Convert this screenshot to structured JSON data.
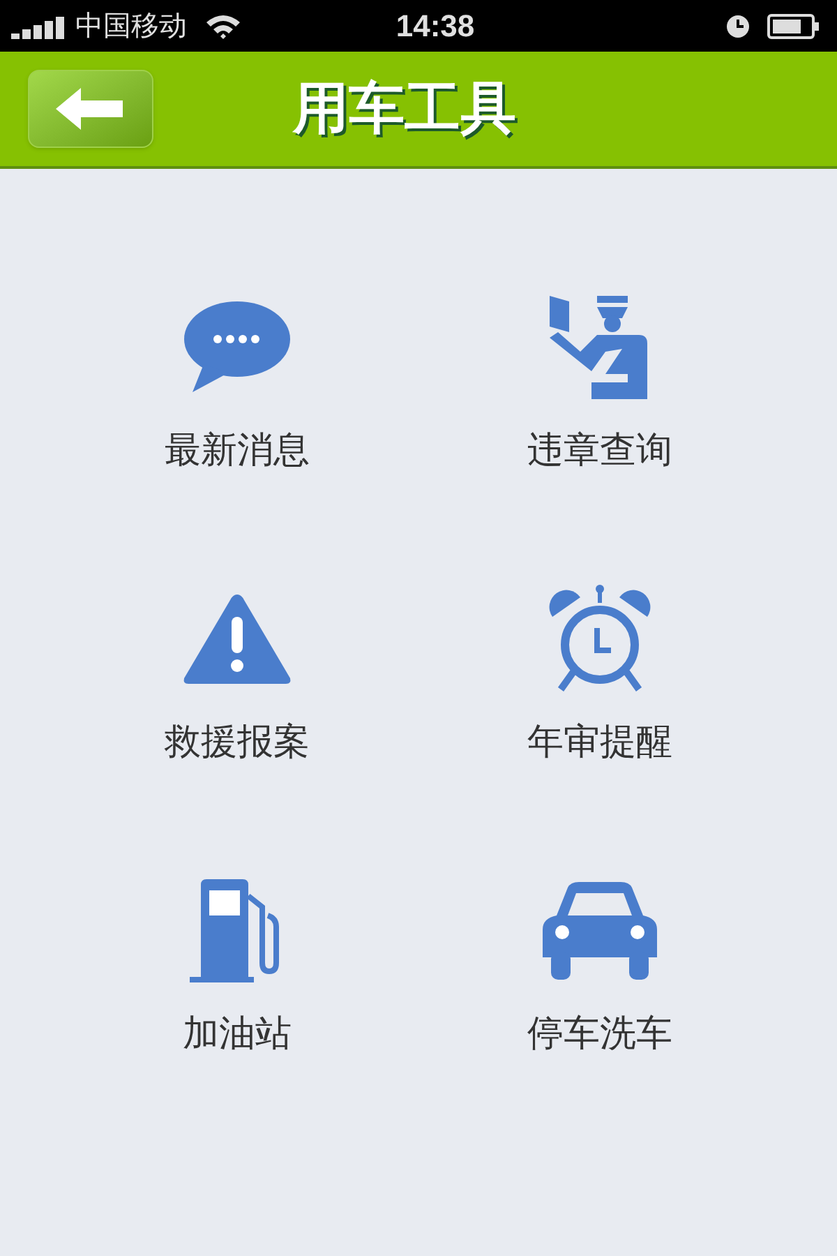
{
  "status_bar": {
    "carrier": "中国移动",
    "time": "14:38"
  },
  "header": {
    "title": "用车工具"
  },
  "tools": [
    {
      "kind": "message",
      "label": "最新消息"
    },
    {
      "kind": "officer",
      "label": "违章查询"
    },
    {
      "kind": "warning",
      "label": "救援报案"
    },
    {
      "kind": "alarm",
      "label": "年审提醒"
    },
    {
      "kind": "fuel",
      "label": "加油站"
    },
    {
      "kind": "car",
      "label": "停车洗车"
    }
  ]
}
